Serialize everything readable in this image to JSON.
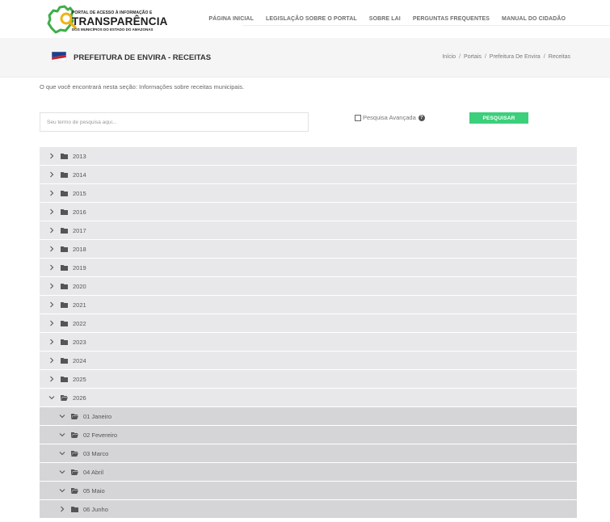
{
  "logo": {
    "line1": "PORTAL DE ACESSO À INFORMAÇÃO E",
    "line2": "TRANSPARÊNCIA",
    "line3": "DOS MUNICÍPIOS DO ESTADO DO AMAZONAS"
  },
  "nav": [
    {
      "label": "PÁGINA INICIAL"
    },
    {
      "label": "LEGISLAÇÃO SOBRE O PORTAL"
    },
    {
      "label": "SOBRE LAI"
    },
    {
      "label": "PERGUNTAS FREQUENTES"
    },
    {
      "label": "MANUAL DO CIDADÃO"
    }
  ],
  "header": {
    "title": "PREFEITURA DE ENVIRA - RECEITAS",
    "breadcrumb": [
      "Início",
      "Portais",
      "Prefeitura De Envira",
      "Receitas"
    ]
  },
  "intro": "O que você encontrará nesta seção: Informações sobre receitas municipais.",
  "search": {
    "placeholder": "Seu termo de pesquisa aqui...",
    "advanced_label": "Pesquisa Avançada",
    "advanced_checked": false,
    "button_label": "PESQUISAR"
  },
  "colors": {
    "accent": "#3ccf7c",
    "row_bg": "#e8e8ea",
    "subrow_bg": "#d5d5d8"
  },
  "tree": [
    {
      "label": "2013",
      "level": 0,
      "expanded": false
    },
    {
      "label": "2014",
      "level": 0,
      "expanded": false
    },
    {
      "label": "2015",
      "level": 0,
      "expanded": false
    },
    {
      "label": "2016",
      "level": 0,
      "expanded": false
    },
    {
      "label": "2017",
      "level": 0,
      "expanded": false
    },
    {
      "label": "2018",
      "level": 0,
      "expanded": false
    },
    {
      "label": "2019",
      "level": 0,
      "expanded": false
    },
    {
      "label": "2020",
      "level": 0,
      "expanded": false
    },
    {
      "label": "2021",
      "level": 0,
      "expanded": false
    },
    {
      "label": "2022",
      "level": 0,
      "expanded": false
    },
    {
      "label": "2023",
      "level": 0,
      "expanded": false
    },
    {
      "label": "2024",
      "level": 0,
      "expanded": false
    },
    {
      "label": "2025",
      "level": 0,
      "expanded": false
    },
    {
      "label": "2026",
      "level": 0,
      "expanded": true
    },
    {
      "label": "01 Janeiro",
      "level": 1,
      "expanded": true
    },
    {
      "label": "02 Fevereiro",
      "level": 1,
      "expanded": true
    },
    {
      "label": "03 Marco",
      "level": 1,
      "expanded": true
    },
    {
      "label": "04 Abril",
      "level": 1,
      "expanded": true
    },
    {
      "label": "05 Maio",
      "level": 1,
      "expanded": true
    },
    {
      "label": "06 Junho",
      "level": 1,
      "expanded": false
    }
  ]
}
